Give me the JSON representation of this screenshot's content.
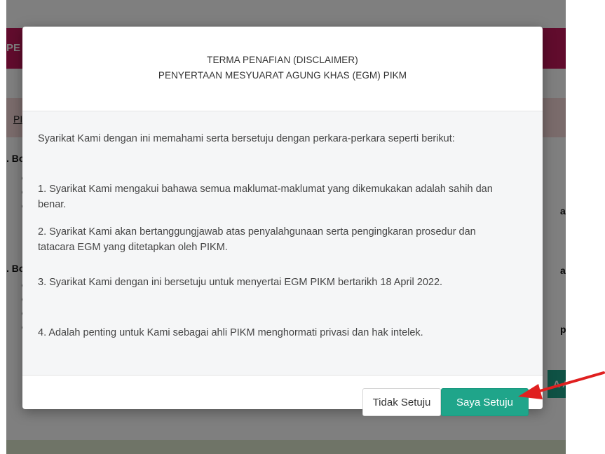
{
  "background": {
    "header_title": "PE",
    "breadcrumb": "PI",
    "section_1_label": ". Bo",
    "section_2_label": ". Bo",
    "right_text_1": "a at",
    "right_text_2": "a be",
    "right_text_3": "peta",
    "green_button_fragment": "A AI"
  },
  "modal": {
    "title_line_1": "TERMA PENAFIAN (DISCLAIMER)",
    "title_line_2": "PENYERTAAN MESYUARAT AGUNG KHAS (EGM) PIKM",
    "intro": "Syarikat Kami dengan ini memahami serta bersetuju dengan perkara-perkara seperti berikut:",
    "points": [
      "1. Syarikat Kami mengakui bahawa semua maklumat-maklumat yang dikemukakan adalah sahih dan benar.",
      "2. Syarikat Kami akan bertanggungjawab atas penyalahgunaan serta pengingkaran prosedur dan tatacara EGM yang ditetapkan oleh PIKM.",
      "3. Syarikat Kami dengan ini bersetuju untuk menyertai EGM PIKM bertarikh 18 April 2022.",
      "4. Adalah penting untuk Kami sebagai ahli PIKM menghormati privasi dan hak intelek."
    ],
    "decline_label": "Tidak Setuju",
    "agree_label": "Saya Setuju"
  },
  "colors": {
    "agree_button": "#1fa58a",
    "header_background": "#c2185b",
    "annotation_arrow": "#e02020"
  }
}
